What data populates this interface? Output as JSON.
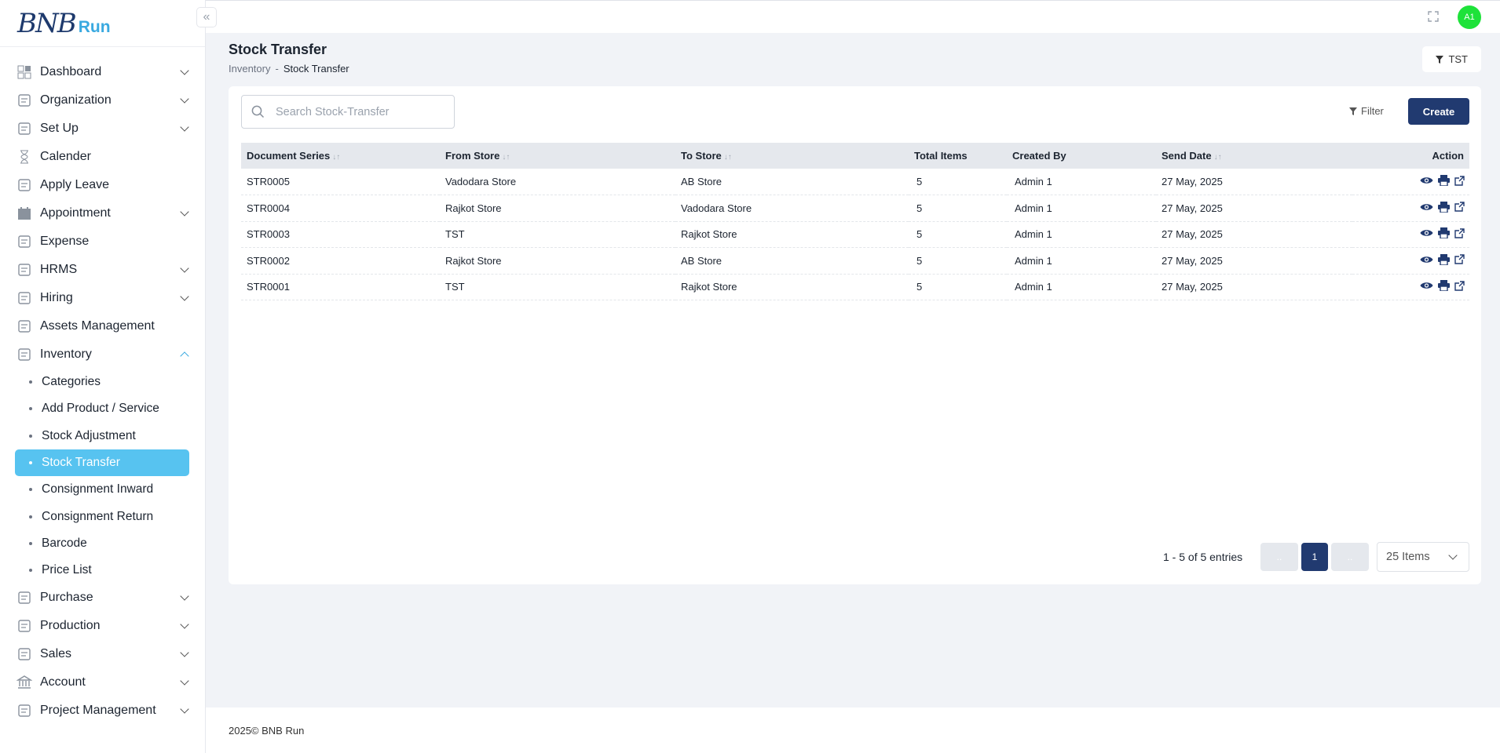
{
  "brand": {
    "mark": "BNB",
    "word": "Run"
  },
  "sidebar": {
    "items": [
      {
        "label": "Dashboard",
        "icon": "dashboard-icon",
        "chevron": true
      },
      {
        "label": "Organization",
        "icon": "organization-icon",
        "chevron": true
      },
      {
        "label": "Set Up",
        "icon": "setup-icon",
        "chevron": true
      },
      {
        "label": "Calender",
        "icon": "hourglass-icon",
        "chevron": false
      },
      {
        "label": "Apply Leave",
        "icon": "leave-icon",
        "chevron": false
      },
      {
        "label": "Appointment",
        "icon": "calendar-icon",
        "chevron": true
      },
      {
        "label": "Expense",
        "icon": "expense-icon",
        "chevron": false
      },
      {
        "label": "HRMS",
        "icon": "hrms-icon",
        "chevron": true
      },
      {
        "label": "Hiring",
        "icon": "hiring-icon",
        "chevron": true
      },
      {
        "label": "Assets Management",
        "icon": "assets-icon",
        "chevron": false
      },
      {
        "label": "Inventory",
        "icon": "inventory-icon",
        "chevron": true,
        "expanded": true
      }
    ],
    "inventory_sub": [
      {
        "label": "Categories"
      },
      {
        "label": "Add Product / Service"
      },
      {
        "label": "Stock Adjustment"
      },
      {
        "label": "Stock Transfer",
        "active": true
      },
      {
        "label": "Consignment Inward"
      },
      {
        "label": "Consignment Return"
      },
      {
        "label": "Barcode"
      },
      {
        "label": "Price List"
      }
    ],
    "after": [
      {
        "label": "Purchase",
        "icon": "purchase-icon",
        "chevron": true
      },
      {
        "label": "Production",
        "icon": "production-icon",
        "chevron": true
      },
      {
        "label": "Sales",
        "icon": "sales-icon",
        "chevron": true
      },
      {
        "label": "Account",
        "icon": "bank-icon",
        "chevron": true
      },
      {
        "label": "Project Management",
        "icon": "project-icon",
        "chevron": true
      }
    ]
  },
  "topbar": {
    "avatar": "A1"
  },
  "page": {
    "title": "Stock Transfer",
    "breadcrumb": [
      "Inventory",
      "-",
      "Stock Transfer"
    ],
    "store_filter": "TST"
  },
  "toolbar": {
    "search_placeholder": "Search Stock-Transfer",
    "filter_label": "Filter",
    "create_label": "Create"
  },
  "table": {
    "columns": [
      "Document Series",
      "From Store",
      "To Store",
      "Total Items",
      "Created By",
      "Send Date",
      "Action"
    ],
    "rows": [
      [
        "STR0005",
        "Vadodara Store",
        "AB Store",
        "5",
        "Admin 1",
        "27 May, 2025"
      ],
      [
        "STR0004",
        "Rajkot Store",
        "Vadodara Store",
        "5",
        "Admin 1",
        "27 May, 2025"
      ],
      [
        "STR0003",
        "TST",
        "Rajkot Store",
        "5",
        "Admin 1",
        "27 May, 2025"
      ],
      [
        "STR0002",
        "Rajkot Store",
        "AB Store",
        "5",
        "Admin 1",
        "27 May, 2025"
      ],
      [
        "STR0001",
        "TST",
        "Rajkot Store",
        "5",
        "Admin 1",
        "27 May, 2025"
      ]
    ]
  },
  "pagination": {
    "entries_text": "1 - 5 of 5 entries",
    "prev": "..",
    "current": "1",
    "next": "..",
    "page_size": "25 Items"
  },
  "footer": {
    "text": "2025© BNB Run"
  },
  "colors": {
    "primary": "#213a70",
    "accent": "#57c3f0",
    "avatar": "#1ee23a"
  }
}
